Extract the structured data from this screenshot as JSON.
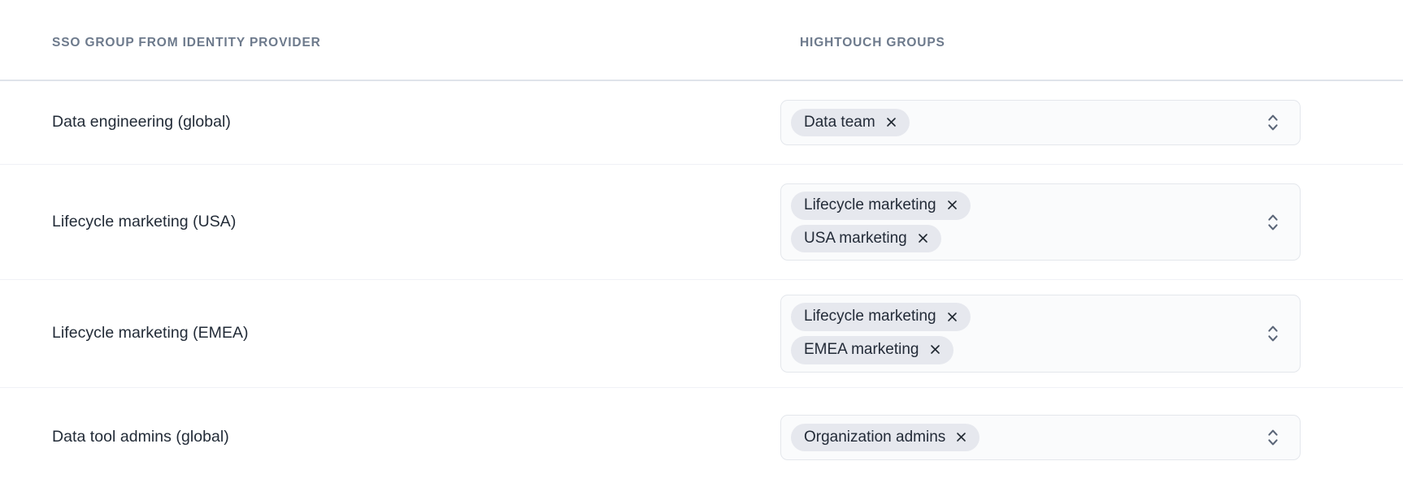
{
  "table": {
    "columns": [
      {
        "key": "sso_group",
        "label": "SSO GROUP FROM IDENTITY PROVIDER"
      },
      {
        "key": "hightouch_groups",
        "label": "HIGHTOUCH GROUPS"
      }
    ],
    "rows": [
      {
        "sso_group": "Data engineering (global)",
        "hightouch_groups": [
          {
            "label": "Data team",
            "remove_icon": "close-icon"
          }
        ],
        "select_icon": "chevron-up-down-icon"
      },
      {
        "sso_group": "Lifecycle marketing (USA)",
        "hightouch_groups": [
          {
            "label": "Lifecycle marketing",
            "remove_icon": "close-icon"
          },
          {
            "label": "USA marketing",
            "remove_icon": "close-icon"
          }
        ],
        "select_icon": "chevron-up-down-icon"
      },
      {
        "sso_group": "Lifecycle marketing (EMEA)",
        "hightouch_groups": [
          {
            "label": "Lifecycle marketing",
            "remove_icon": "close-icon"
          },
          {
            "label": "EMEA marketing",
            "remove_icon": "close-icon"
          }
        ],
        "select_icon": "chevron-up-down-icon"
      },
      {
        "sso_group": "Data tool admins (global)",
        "hightouch_groups": [
          {
            "label": "Organization admins",
            "remove_icon": "close-icon"
          }
        ],
        "select_icon": "chevron-up-down-icon"
      }
    ]
  },
  "colors": {
    "page_background": "#ffffff",
    "header_text": "#6d7a8c",
    "header_divider": "#dfe3ea",
    "row_divider": "#f0f1f6",
    "row_label_text": "#222b37",
    "select_background": "#fafbfc",
    "select_border": "#e4e7ec",
    "tag_background": "#e6e8ee",
    "tag_text": "#232b38",
    "stepper_icon": "#5b6678"
  }
}
